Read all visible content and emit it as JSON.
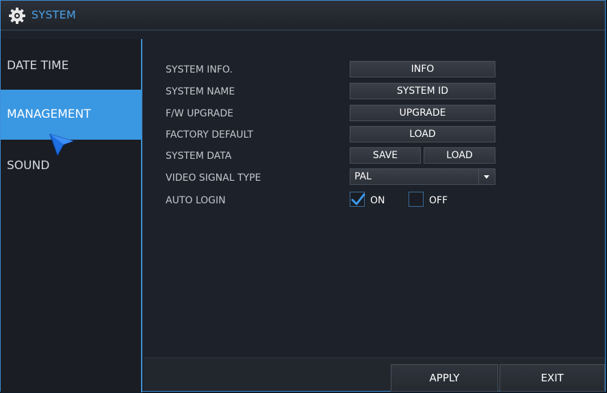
{
  "titlebar": {
    "title": "SYSTEM",
    "icon": "gear-icon"
  },
  "sidebar": {
    "items": [
      {
        "label": "DATE TIME",
        "active": false
      },
      {
        "label": "MANAGEMENT",
        "active": true
      },
      {
        "label": "SOUND",
        "active": false
      }
    ]
  },
  "settings": {
    "system_info": {
      "label": "SYSTEM INFO.",
      "button": "INFO"
    },
    "system_name": {
      "label": "SYSTEM NAME",
      "button": "SYSTEM ID"
    },
    "fw_upgrade": {
      "label": "F/W UPGRADE",
      "button": "UPGRADE"
    },
    "factory_default": {
      "label": "FACTORY DEFAULT",
      "button": "LOAD"
    },
    "system_data": {
      "label": "SYSTEM DATA",
      "save_button": "SAVE",
      "load_button": "LOAD"
    },
    "video_signal_type": {
      "label": "VIDEO SIGNAL TYPE",
      "value": "PAL"
    },
    "auto_login": {
      "label": "AUTO LOGIN",
      "on_label": "ON",
      "off_label": "OFF",
      "on_checked": true,
      "off_checked": false
    }
  },
  "footer": {
    "apply_label": "APPLY",
    "exit_label": "EXIT"
  },
  "colors": {
    "accent": "#3a97e2",
    "title_text": "#4aa3ea",
    "background": "#1d2129",
    "check": "#3b9cf0"
  }
}
